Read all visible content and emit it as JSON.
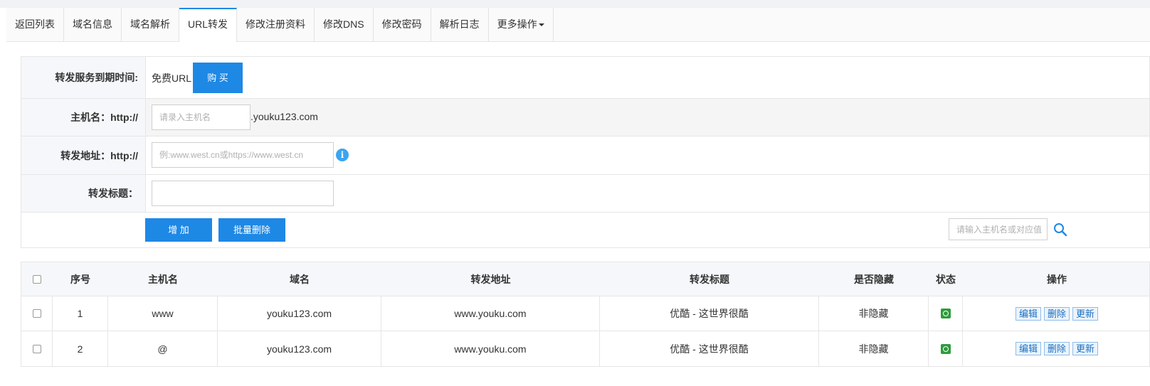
{
  "tabs": [
    {
      "label": "返回列表"
    },
    {
      "label": "域名信息"
    },
    {
      "label": "域名解析"
    },
    {
      "label": "URL转发"
    },
    {
      "label": "修改注册资料"
    },
    {
      "label": "修改DNS"
    },
    {
      "label": "修改密码"
    },
    {
      "label": "解析日志"
    },
    {
      "label": "更多操作"
    }
  ],
  "form": {
    "expire_label": "转发服务到期时间:",
    "expire_value": "免费URL",
    "buy_button": "购 买",
    "host_label": "主机名：http://",
    "host_placeholder": "请录入主机名",
    "domain_suffix": ".youku123.com",
    "url_label": "转发地址：http://",
    "url_placeholder": "例:www.west.cn或https://www.west.cn",
    "title_label": "转发标题：",
    "title_value": "",
    "add_button": "增 加",
    "batch_delete_button": "批量删除",
    "search_placeholder": "请输入主机名或对应值"
  },
  "table": {
    "headers": [
      "序号",
      "主机名",
      "域名",
      "转发地址",
      "转发标题",
      "是否隐藏",
      "状态",
      "操作"
    ],
    "rows": [
      {
        "index": "1",
        "host": "www",
        "domain": "youku123.com",
        "url": "www.youku.com",
        "title": "优酷 - 这世界很酷",
        "hidden": "非隐藏"
      },
      {
        "index": "2",
        "host": "@",
        "domain": "youku123.com",
        "url": "www.youku.com",
        "title": "优酷 - 这世界很酷",
        "hidden": "非隐藏"
      }
    ],
    "actions": {
      "edit": "编辑",
      "delete": "删除",
      "update": "更新"
    }
  },
  "colors": {
    "accent": "#1e88e5",
    "status_on": "#2e9c3c",
    "info": "#3ba5f0"
  },
  "icons": {
    "info": "info-icon",
    "search": "search-icon",
    "status": "status-enabled-icon"
  }
}
